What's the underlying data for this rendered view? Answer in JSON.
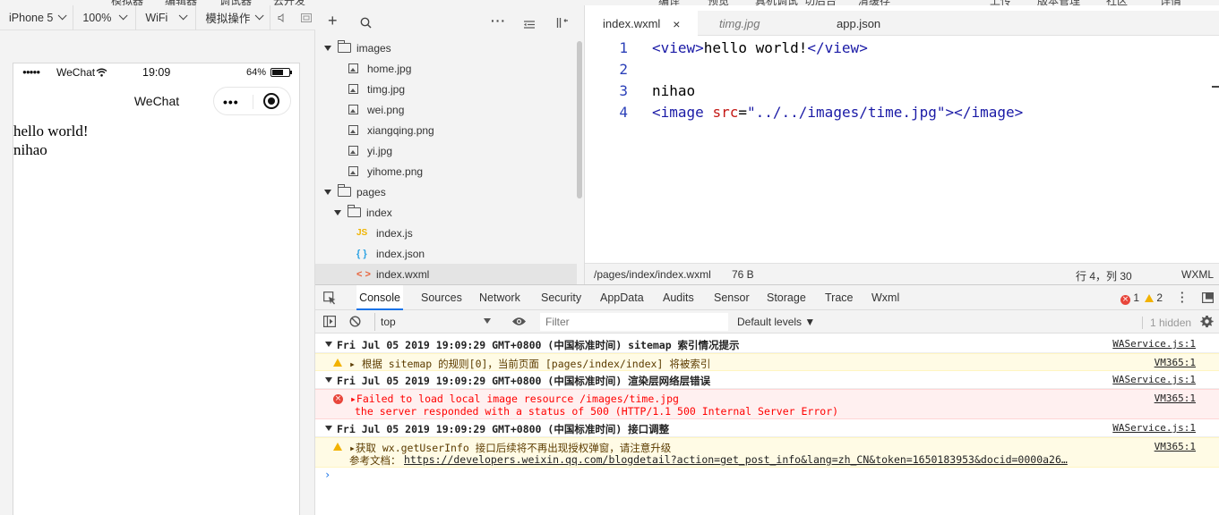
{
  "top_strip": [
    "模拟器",
    "编辑器",
    "调试器",
    "云开发",
    "编译",
    "预览",
    "真机调试",
    "切后台",
    "清缓存",
    "上传",
    "版本管理",
    "社区",
    "详情"
  ],
  "simulator": {
    "toolbar": {
      "device": "iPhone 5",
      "zoom": "100%",
      "network": "WiFi",
      "operation": "模拟操作"
    },
    "status_bar": {
      "signal": "●●●●●",
      "carrier": "WeChat",
      "time": "19:09",
      "battery": "64%"
    },
    "nav_title": "WeChat",
    "capsule_dots": "•••",
    "page_lines": [
      "hello world!",
      "nihao"
    ]
  },
  "file_tree": {
    "toolbar": {
      "add": "+",
      "search": "search",
      "more": "···"
    },
    "items": [
      {
        "name": "images",
        "type": "folder"
      },
      {
        "name": "home.jpg",
        "type": "image"
      },
      {
        "name": "timg.jpg",
        "type": "image"
      },
      {
        "name": "wei.png",
        "type": "image"
      },
      {
        "name": "xiangqing.png",
        "type": "image"
      },
      {
        "name": "yi.jpg",
        "type": "image"
      },
      {
        "name": "yihome.png",
        "type": "image"
      },
      {
        "name": "pages",
        "type": "folder"
      },
      {
        "name": "index",
        "type": "folder"
      },
      {
        "name": "index.js",
        "type": "js"
      },
      {
        "name": "index.json",
        "type": "json"
      },
      {
        "name": "index.wxml",
        "type": "wxml",
        "selected": true
      }
    ],
    "icons": {
      "js": "JS",
      "json": "{ }",
      "wxml": "< >"
    }
  },
  "editor": {
    "tabs": [
      {
        "label": "index.wxml",
        "active": true,
        "close": "×"
      },
      {
        "label": "timg.jpg",
        "italic": true
      },
      {
        "label": "app.json"
      }
    ],
    "lines": [
      {
        "n": "1",
        "parts": [
          [
            "tg",
            "<view>"
          ],
          [
            "tx",
            "hello world!"
          ],
          [
            "tg",
            "</view>"
          ]
        ]
      },
      {
        "n": "2",
        "parts": []
      },
      {
        "n": "3",
        "parts": [
          [
            "tx",
            "nihao"
          ]
        ]
      },
      {
        "n": "4",
        "parts": [
          [
            "tg",
            "<image "
          ],
          [
            "at",
            "src"
          ],
          [
            "tx",
            "="
          ],
          [
            "st",
            "\"../../images/time.jpg\""
          ],
          [
            "tg",
            "></image>"
          ]
        ]
      }
    ],
    "status": {
      "path": "/pages/index/index.wxml",
      "size": "76 B",
      "position": "行 4，列 30",
      "lang": "WXML"
    }
  },
  "devtools": {
    "tabs": [
      "Console",
      "Sources",
      "Network",
      "Security",
      "AppData",
      "Audits",
      "Sensor",
      "Storage",
      "Trace",
      "Wxml"
    ],
    "active_tab": "Console",
    "error_count": "1",
    "warning_count": "2",
    "toolbar": {
      "context": "top",
      "filter_placeholder": "Filter",
      "levels": "Default levels ▼",
      "hidden": "1 hidden"
    },
    "logs": [
      {
        "kind": "head",
        "text": "Fri Jul 05 2019 19:09:29 GMT+0800 (中国标准时间) sitemap 索引情况提示",
        "src": "WAService.js:1"
      },
      {
        "kind": "warn",
        "lines": [
          "▸ 根据 sitemap 的规则[0]，当前页面 [pages/index/index] 将被索引"
        ],
        "src": "VM365:1"
      },
      {
        "kind": "head",
        "text": "Fri Jul 05 2019 19:09:29 GMT+0800 (中国标准时间) 渲染层网络层错误",
        "src": "WAService.js:1"
      },
      {
        "kind": "error",
        "lines": [
          "▸Failed to load local image resource /images/time.jpg",
          "the server responded with a status of 500 (HTTP/1.1 500 Internal Server Error)"
        ],
        "src": "VM365:1",
        "icon": "×"
      },
      {
        "kind": "head",
        "text": "Fri Jul 05 2019 19:09:29 GMT+0800 (中国标准时间) 接口调整",
        "src": "WAService.js:1"
      },
      {
        "kind": "warn",
        "lines": [
          "▸获取 wx.getUserInfo 接口后续将不再出现授权弹窗，请注意升级",
          "参考文档："
        ],
        "link": "https://developers.weixin.qq.com/blogdetail?action=get_post_info&lang=zh_CN&token=1650183953&docid=0000a26…",
        "src": "VM365:1"
      }
    ],
    "prompt": "›"
  },
  "colors": {
    "accent": "#1a73e8",
    "error": "#e8463b",
    "warning": "#f2b200",
    "tag": "#1a1aa6",
    "attr": "#c41a16"
  }
}
